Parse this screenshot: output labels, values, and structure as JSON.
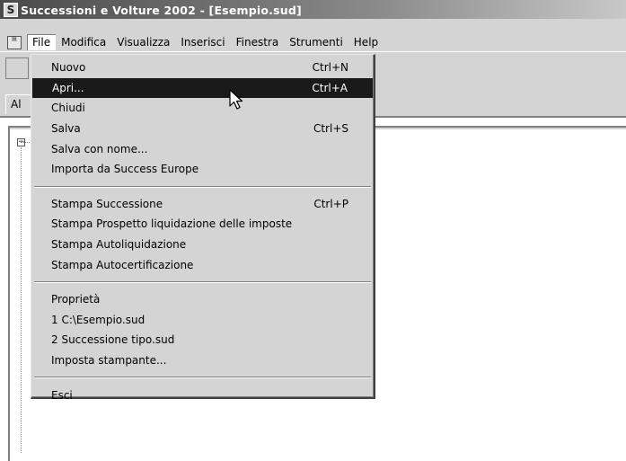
{
  "window": {
    "title": "Successioni e Volture 2002 - [Esempio.sud]",
    "app_icon_letter": "S"
  },
  "menubar": {
    "system_icon": "document-icon",
    "items": [
      {
        "label": "File",
        "active": true
      },
      {
        "label": "Modifica"
      },
      {
        "label": "Visualizza"
      },
      {
        "label": "Inserisci"
      },
      {
        "label": "Finestra"
      },
      {
        "label": "Strumenti"
      },
      {
        "label": "Help"
      }
    ]
  },
  "tabstrip": {
    "tab_label": "Al"
  },
  "tree": {
    "expander": "⊟"
  },
  "file_menu": {
    "groups": [
      [
        {
          "label": "Nuovo",
          "shortcut": "Ctrl+N"
        },
        {
          "label": "Apri...",
          "shortcut": "Ctrl+A",
          "highlighted": true
        },
        {
          "label": "Chiudi",
          "shortcut": ""
        },
        {
          "label": "Salva",
          "shortcut": "Ctrl+S"
        },
        {
          "label": "Salva con nome...",
          "shortcut": ""
        },
        {
          "label": "Importa da Success Europe",
          "shortcut": ""
        }
      ],
      [
        {
          "label": "Stampa Successione",
          "shortcut": "Ctrl+P"
        },
        {
          "label": "Stampa Prospetto liquidazione delle imposte",
          "shortcut": ""
        },
        {
          "label": "Stampa Autoliquidazione",
          "shortcut": ""
        },
        {
          "label": "Stampa Autocertificazione",
          "shortcut": ""
        }
      ],
      [
        {
          "label": "Proprietà",
          "shortcut": ""
        },
        {
          "label": "1 C:\\Esempio.sud",
          "shortcut": ""
        },
        {
          "label": "2 Successione tipo.sud",
          "shortcut": ""
        },
        {
          "label": "Imposta stampante...",
          "shortcut": ""
        }
      ],
      [
        {
          "label": "Esci",
          "shortcut": ""
        }
      ]
    ]
  },
  "colors": {
    "menu_bg": "#d4d4d4",
    "highlight_bg": "#1a1a1a",
    "highlight_fg": "#ffffff"
  }
}
